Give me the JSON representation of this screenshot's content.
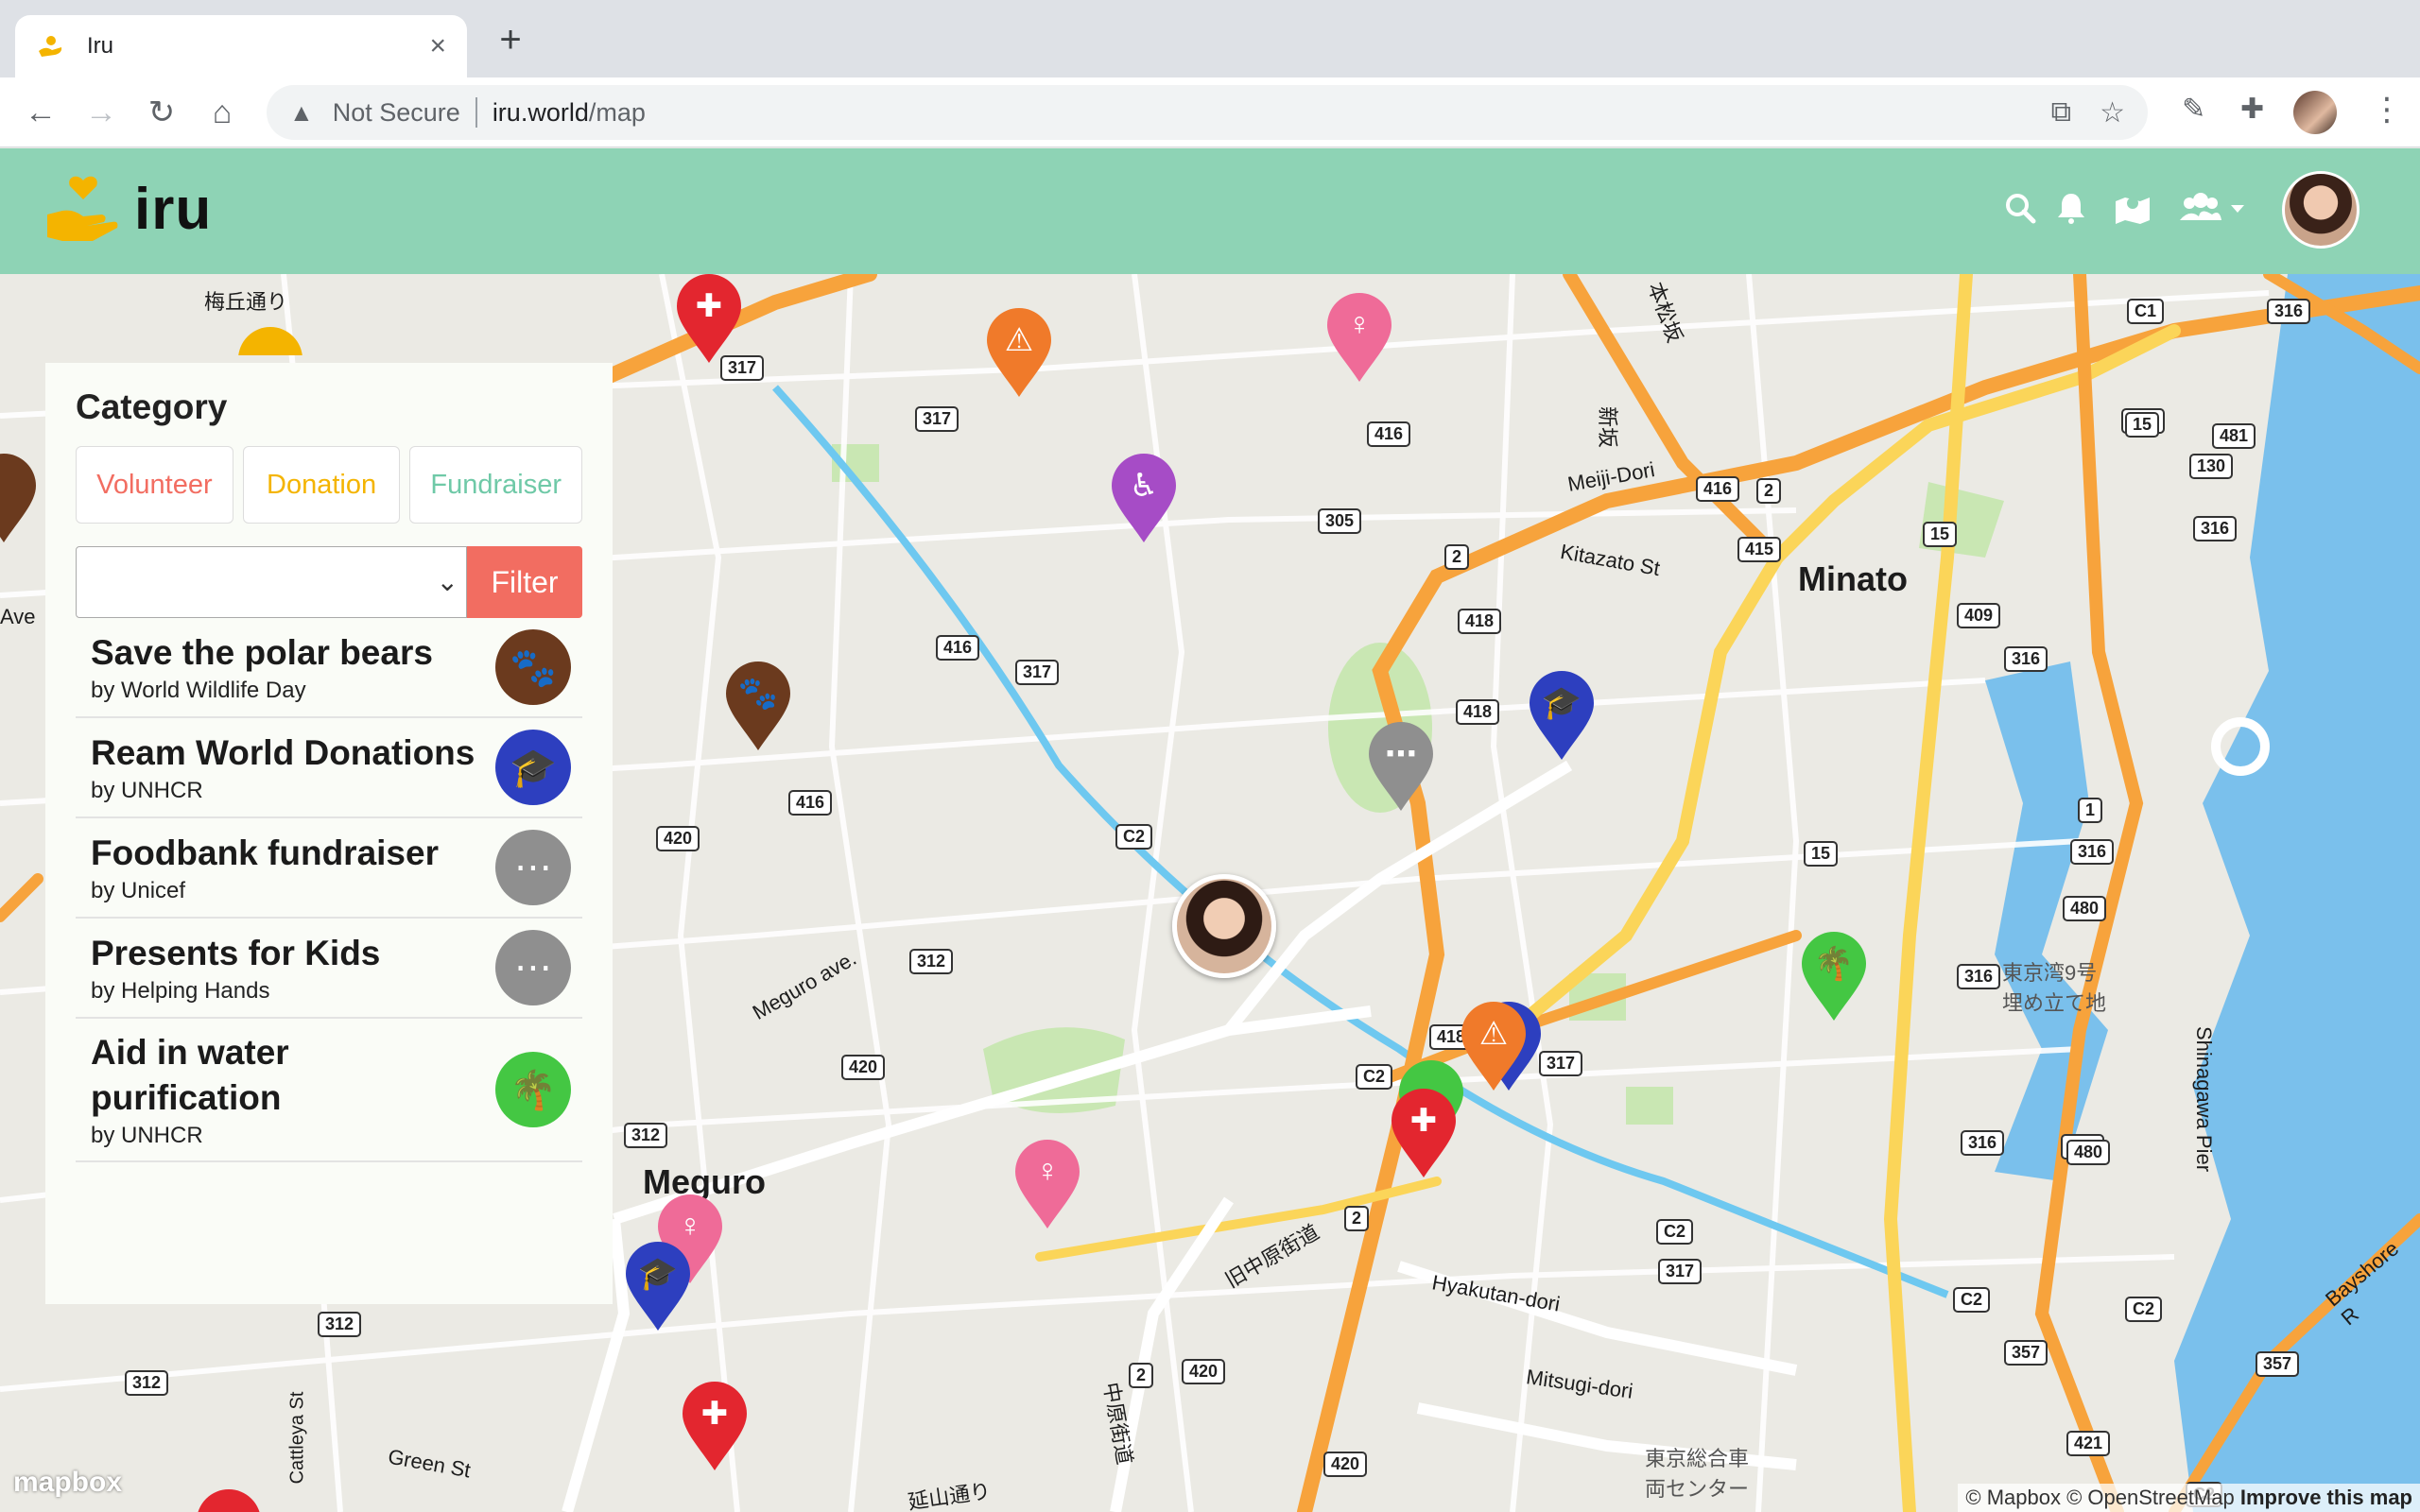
{
  "browser": {
    "tab_title": "Iru",
    "new_tab": "+",
    "close_tab": "×",
    "security_label": "Not Secure",
    "url_host": "iru.world",
    "url_path": "/map"
  },
  "app": {
    "brand": "iru"
  },
  "panel": {
    "heading": "Category",
    "categories": [
      {
        "label": "Volunteer",
        "color": "#f26d61"
      },
      {
        "label": "Donation",
        "color": "#f4b400"
      },
      {
        "label": "Fundraiser",
        "color": "#6fc9a7"
      }
    ],
    "select_value": "",
    "filter_label": "Filter",
    "items": [
      {
        "title": "Save the polar bears",
        "by": "by World Wildlife Day",
        "icon": "paw-icon",
        "color": "#6b3a1e"
      },
      {
        "title": "Ream World Donations",
        "by": "by UNHCR",
        "icon": "graduation-cap-icon",
        "color": "#2d3fbf"
      },
      {
        "title": "Foodbank fundraiser",
        "by": "by Unicef",
        "icon": "ellipsis-icon",
        "color": "#8f8f8f"
      },
      {
        "title": "Presents for Kids",
        "by": "by Helping Hands",
        "icon": "ellipsis-icon",
        "color": "#8f8f8f"
      },
      {
        "title": "Aid in water purification",
        "by": "by UNHCR",
        "icon": "palm-tree-icon",
        "color": "#44c743"
      }
    ]
  },
  "map": {
    "places": {
      "minato": "Minato",
      "meguro": "Meguro"
    },
    "street_labels": {
      "umegaoka": "梅丘通り",
      "meiji_dori": "Meiji-Dori",
      "kitazato": "Kitazato St",
      "meguro_ave": "Meguro ave.",
      "hyakutan": "Hyakutan-dori",
      "mitsugi": "Mitsugi-dori",
      "green_st": "Green St",
      "kyu_nakahara": "旧中原街道",
      "nakahara": "中原街道",
      "enzan": "延山通り",
      "shinagawa_pier": "Shinagawa Pier",
      "bayshore": "Bayshore R",
      "tokyo_bay": "東京湾9号 埋め立て地",
      "tokyo_center": "東京総合車 両センター",
      "shinzaka": "新坂",
      "honmatsuzaka": "本松坂",
      "ave": "Ave",
      "cattleya": "Cattleya St"
    },
    "road_numbers": [
      "317",
      "317",
      "416",
      "305",
      "2",
      "418",
      "418",
      "416",
      "2",
      "415",
      "C1",
      "316",
      "409",
      "15",
      "130",
      "481",
      "316",
      "15",
      "409",
      "316",
      "416",
      "317",
      "420",
      "416",
      "C2",
      "312",
      "420",
      "312",
      "312",
      "2",
      "420",
      "420",
      "2",
      "C2",
      "418",
      "317",
      "C2",
      "317",
      "1",
      "316",
      "480",
      "15",
      "316",
      "316",
      "316",
      "480",
      "C2",
      "357",
      "C2",
      "357",
      "421",
      "C2",
      "312"
    ],
    "attribution_prefix": "© Mapbox © OpenStreetMap",
    "attribution_link": "Improve this map",
    "logo_text": "mapbox"
  },
  "colors": {
    "header": "#8ed3b5",
    "filter": "#f26d61",
    "red_cross": "#e3262f",
    "warning": "#f07a2a",
    "female": "#ef6b98",
    "accessible": "#a64cc6",
    "paw": "#6b3a1e",
    "education": "#2d3fbf",
    "ellipsis": "#8f8f8f",
    "palm": "#44c743"
  }
}
